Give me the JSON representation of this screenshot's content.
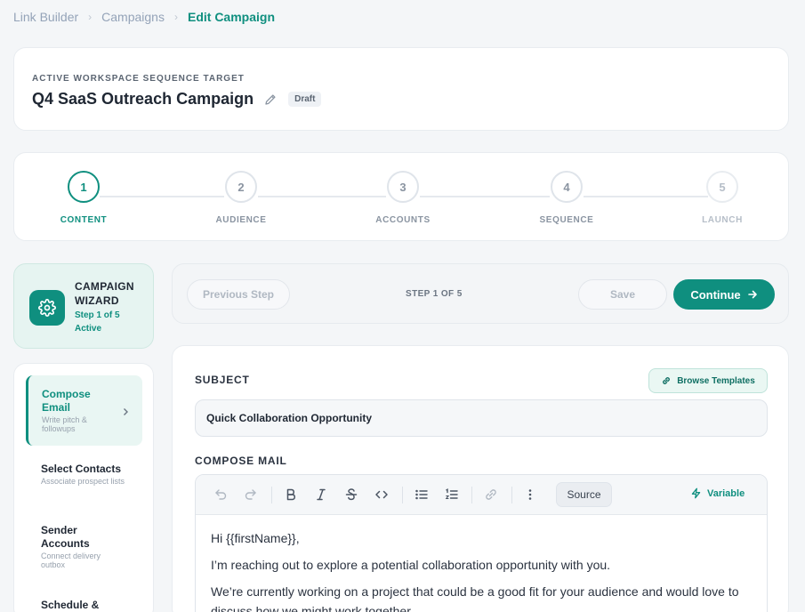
{
  "breadcrumb": {
    "items": [
      "Link Builder",
      "Campaigns"
    ],
    "current": "Edit Campaign"
  },
  "header": {
    "eyebrow": "ACTIVE WORKSPACE SEQUENCE TARGET",
    "title": "Q4 SaaS Outreach Campaign",
    "status_badge": "Draft"
  },
  "stepper": {
    "steps": [
      {
        "number": "1",
        "label": "CONTENT",
        "state": "active"
      },
      {
        "number": "2",
        "label": "AUDIENCE",
        "state": "pending"
      },
      {
        "number": "3",
        "label": "ACCOUNTS",
        "state": "pending"
      },
      {
        "number": "4",
        "label": "SEQUENCE",
        "state": "pending"
      },
      {
        "number": "5",
        "label": "LAUNCH",
        "state": "disabled"
      }
    ]
  },
  "wizard": {
    "title": "CAMPAIGN WIZARD",
    "subtitle": "Step 1 of 5 Active",
    "icon": "gear-icon"
  },
  "sidebar": {
    "items": [
      {
        "label": "Compose Email",
        "desc": "Write pitch & followups",
        "active": true
      },
      {
        "label": "Select Contacts",
        "desc": "Associate prospect lists",
        "active": false
      },
      {
        "label": "Sender Accounts",
        "desc": "Connect delivery outbox",
        "active": false
      },
      {
        "label": "Schedule &",
        "desc": "",
        "active": false
      }
    ]
  },
  "toolbar": {
    "prev_label": "Previous Step",
    "step_count": "STEP 1 OF 5",
    "save_label": "Save",
    "continue_label": "Continue"
  },
  "editor": {
    "subject_label": "SUBJECT",
    "browse_label": "Browse Templates",
    "subject_value": "Quick Collaboration Opportunity",
    "compose_label": "COMPOSE MAIL",
    "source_label": "Source",
    "variable_label": "Variable",
    "body": [
      "Hi {{firstName}},",
      "I’m reaching out to explore a potential collaboration opportunity with you.",
      "We’re currently working on a project that could be a good fit for your audience and would love to discuss how we might work together."
    ]
  },
  "colors": {
    "accent": "#0f8f7f",
    "background": "#f4f6f8",
    "wizard_bg": "#e6f4f1"
  }
}
